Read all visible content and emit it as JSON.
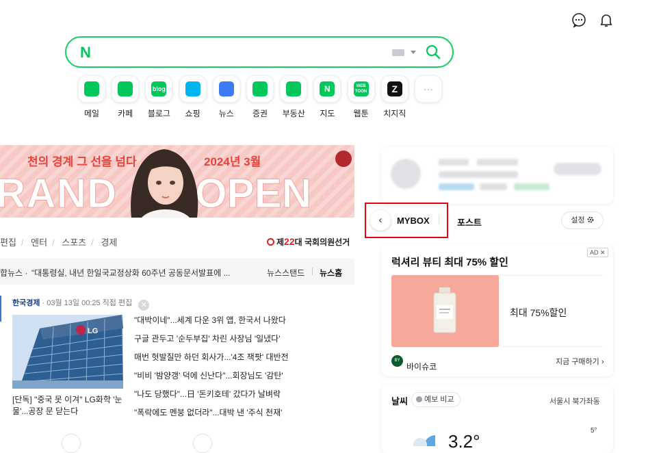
{
  "header": {
    "icons": [
      "chat-icon",
      "bell-icon"
    ]
  },
  "search": {
    "logo": "N",
    "placeholder": ""
  },
  "shortcuts": [
    {
      "label": "메일",
      "icon": "mail-icon",
      "color": "#03c75a"
    },
    {
      "label": "카페",
      "icon": "cafe-icon",
      "color": "#03c75a"
    },
    {
      "label": "블로그",
      "icon": "blog-icon",
      "color": "#03c75a",
      "glyph": "blog"
    },
    {
      "label": "쇼핑",
      "icon": "shopping-icon",
      "color": "#00b4f0"
    },
    {
      "label": "뉴스",
      "icon": "news-icon",
      "color": "#3b7cf5"
    },
    {
      "label": "증권",
      "icon": "stock-icon",
      "color": "#03c75a"
    },
    {
      "label": "부동산",
      "icon": "realestate-icon",
      "color": "#03c75a"
    },
    {
      "label": "지도",
      "icon": "map-icon",
      "color": "#03c75a",
      "glyph": "N"
    },
    {
      "label": "웹툰",
      "icon": "webtoon-icon",
      "color": "#03c75a",
      "glyph": "WEB TOON"
    },
    {
      "label": "치지직",
      "icon": "chzzk-icon",
      "color": "#111111",
      "glyph": "Z"
    },
    {
      "label": "",
      "icon": "more-icon",
      "color": "#9aa1ab",
      "glyph": "···"
    }
  ],
  "banner": {
    "line1": "천의 경계 그 선을 넘다",
    "line2": "2024년 3월",
    "big_left": "RAND",
    "big_right": "OPEN"
  },
  "news": {
    "tabs": [
      "편집",
      "엔터",
      "스포츠",
      "경제"
    ],
    "election": {
      "prefix": "제",
      "number": "22",
      "suffix": "대 국회의원선거"
    },
    "headline_label": "합뉴스 ·",
    "headline": "\"대통령실, 내년 한일국교정상화 60주년 공동문서발표에 ...",
    "newsstand": "뉴스스탠드",
    "news_home": "뉴스홈",
    "press_name": "한국경제",
    "press_meta": "· 03월 13일 00:25 직접 편집",
    "press_close": "✕",
    "thumb_caption": "[단독] \"중국 못 이겨\" LG화학 '눈물'...공장 문 닫는다",
    "items": [
      "\"대박이네\"...세계 다운 3위 앱, 한국서 나왔다",
      "구글 관두고 '순두부집' 차린 사장님 '일냈다'",
      "매번 헛발질만 하던 회사가...'4조 잭팟' 대반전",
      "\"비비 '밤양갱' 덕에 신난다\"...회장님도 '감탄'",
      "\"나도 당했다\"...日 '돈키호테' 갔다가 날벼락",
      "\"폭락에도 멘붕 없더라\"...대박 낸 '주식 천재'"
    ]
  },
  "panel": {
    "back": "‹",
    "tab_mybox": "MYBOX",
    "tab_post": "포스트",
    "settings": "설정"
  },
  "ad": {
    "badge": "AD ✕",
    "title": "럭셔리 뷰티 최대 75% 할인",
    "desc": "최대 75%할인",
    "brand_logo": "BY SUCO",
    "brand": "바이슈코",
    "buy": "지금 구매하기 ›"
  },
  "weather": {
    "title": "날씨",
    "compare": "예보 비교",
    "location": "서울시 북가좌동",
    "temp": "3.2°",
    "small": "5°"
  },
  "colors": {
    "naver_green": "#03c75a",
    "highlight_red": "#e60012"
  }
}
